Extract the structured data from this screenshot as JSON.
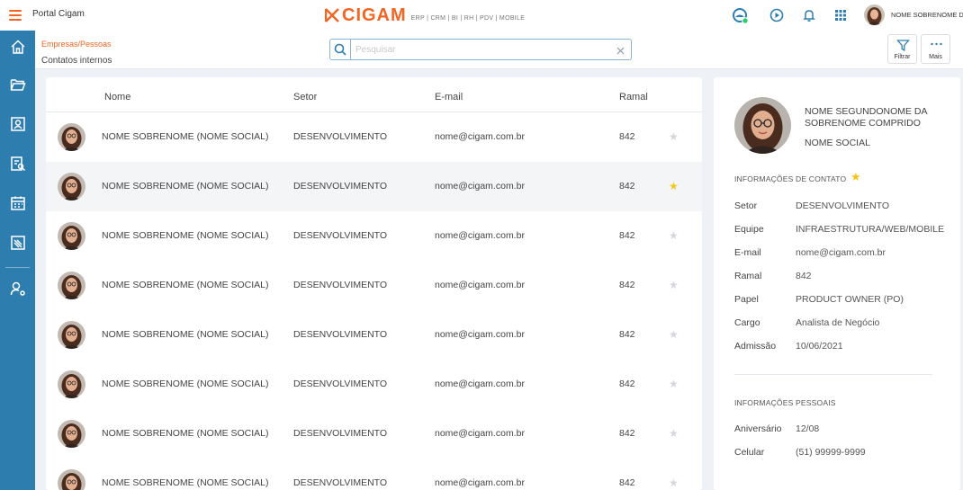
{
  "header": {
    "portal_title": "Portal Cigam",
    "logo_text": "CIGAM",
    "logo_sub": "ERP | CRM | BI | RH | PDV | MOBILE",
    "user_name": "NOME SOBRENOME D..."
  },
  "breadcrumb": "Empresas/Pessoas",
  "page_title": "Contatos internos",
  "search": {
    "placeholder": "Pesquisar",
    "value": ""
  },
  "actions": {
    "filter_label": "Filtrar",
    "more_label": "Mais"
  },
  "table": {
    "columns": [
      "Nome",
      "Setor",
      "E-mail",
      "Ramal"
    ],
    "rows": [
      {
        "name": "NOME SOBRENOME (NOME SOCIAL)",
        "sector": "DESENVOLVIMENTO",
        "email": "nome@cigam.com.br",
        "ext": "842",
        "favorite": false
      },
      {
        "name": "NOME SOBRENOME (NOME SOCIAL)",
        "sector": "DESENVOLVIMENTO",
        "email": "nome@cigam.com.br",
        "ext": "842",
        "favorite": true
      },
      {
        "name": "NOME SOBRENOME (NOME SOCIAL)",
        "sector": "DESENVOLVIMENTO",
        "email": "nome@cigam.com.br",
        "ext": "842",
        "favorite": false
      },
      {
        "name": "NOME SOBRENOME (NOME SOCIAL)",
        "sector": "DESENVOLVIMENTO",
        "email": "nome@cigam.com.br",
        "ext": "842",
        "favorite": false
      },
      {
        "name": "NOME SOBRENOME (NOME SOCIAL)",
        "sector": "DESENVOLVIMENTO",
        "email": "nome@cigam.com.br",
        "ext": "842",
        "favorite": false
      },
      {
        "name": "NOME SOBRENOME (NOME SOCIAL)",
        "sector": "DESENVOLVIMENTO",
        "email": "nome@cigam.com.br",
        "ext": "842",
        "favorite": false
      },
      {
        "name": "NOME SOBRENOME (NOME SOCIAL)",
        "sector": "DESENVOLVIMENTO",
        "email": "nome@cigam.com.br",
        "ext": "842",
        "favorite": false
      },
      {
        "name": "NOME SOBRENOME (NOME SOCIAL)",
        "sector": "DESENVOLVIMENTO",
        "email": "nome@cigam.com.br",
        "ext": "842",
        "favorite": false
      }
    ]
  },
  "detail": {
    "full_name": "NOME SEGUNDONOME DA SOBRENOME COMPRIDO",
    "social_name": "NOME SOCIAL",
    "contact_section": "INFORMAÇÕES DE CONTATO",
    "contact_fields": [
      {
        "label": "Setor",
        "value": "DESENVOLVIMENTO"
      },
      {
        "label": "Equipe",
        "value": "INFRAESTRUTURA/WEB/MOBILE"
      },
      {
        "label": "E-mail",
        "value": "nome@cigam.com.br"
      },
      {
        "label": "Ramal",
        "value": "842"
      },
      {
        "label": "Papel",
        "value": "PRODUCT OWNER (PO)"
      },
      {
        "label": "Cargo",
        "value": "Analista de Negócio"
      },
      {
        "label": "Admissão",
        "value": "10/06/2021"
      }
    ],
    "personal_section": "INFORMAÇÕES PESSOAIS",
    "personal_fields": [
      {
        "label": "Aniversário",
        "value": "12/08"
      },
      {
        "label": "Celular",
        "value": "(51) 99999-9999"
      }
    ]
  },
  "sidebar": {
    "items": [
      "home-icon",
      "folder-icon",
      "contacts-icon",
      "directory-icon",
      "calendar-icon",
      "reports-icon",
      "user-settings-icon"
    ]
  },
  "colors": {
    "accent": "#f26522",
    "sidebar": "#2d7eaf",
    "favorite_star": "#f5c518",
    "inactive_star": "#d4d7db"
  }
}
